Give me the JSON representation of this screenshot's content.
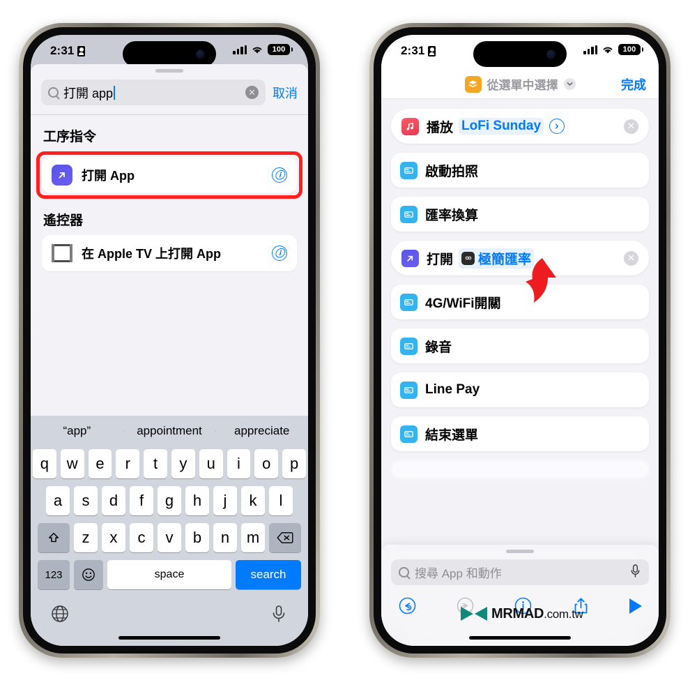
{
  "status_bar": {
    "time": "2:31",
    "battery": "100",
    "lock_icon": "lock-portrait-icon",
    "signal_icon": "cellular-signal-icon",
    "wifi_icon": "wifi-icon"
  },
  "left_phone": {
    "search": {
      "value": "打開 app",
      "clear_label": "✕",
      "cancel_label": "取消",
      "search_icon": "search-icon"
    },
    "sections": [
      {
        "title": "工序指令",
        "highlighted": true,
        "items": [
          {
            "label": "打開 App",
            "icon": "open-app-icon",
            "info": "ⓘ"
          }
        ]
      },
      {
        "title": "遙控器",
        "highlighted": false,
        "items": [
          {
            "label": "在 Apple TV 上打開 App",
            "icon": "apple-tv-icon",
            "info": "ⓘ"
          }
        ]
      }
    ],
    "keyboard": {
      "predictions": [
        "“app”",
        "appointment",
        "appreciate"
      ],
      "row1": [
        "q",
        "w",
        "e",
        "r",
        "t",
        "y",
        "u",
        "i",
        "o",
        "p"
      ],
      "row2": [
        "a",
        "s",
        "d",
        "f",
        "g",
        "h",
        "j",
        "k",
        "l"
      ],
      "row3": [
        "z",
        "x",
        "c",
        "v",
        "b",
        "n",
        "m"
      ],
      "shift_icon": "shift-arrow-icon",
      "backspace_icon": "backspace-icon",
      "numbers_label": "123",
      "emoji_icon": "emoji-smiley-icon",
      "space_label": "space",
      "search_label": "search",
      "globe_icon": "globe-icon",
      "mic_icon": "microphone-icon"
    }
  },
  "right_phone": {
    "header": {
      "shortcut_name": "從選單中選擇",
      "icon": "menu-select-icon",
      "chevron_icon": "chevron-down-icon",
      "done_label": "完成"
    },
    "actions": [
      {
        "verb": "播放",
        "param": "LoFi Sunday",
        "icon": "music-icon",
        "style": "pill",
        "has_chevron": true,
        "has_x": true
      },
      {
        "verb": "啟動拍照",
        "param": "",
        "icon": "shortcut-icon",
        "style": "card",
        "has_chevron": false,
        "has_x": false
      },
      {
        "verb": "匯率換算",
        "param": "",
        "icon": "shortcut-icon",
        "style": "card",
        "has_chevron": false,
        "has_x": false
      },
      {
        "verb": "打開",
        "param": "極簡匯率",
        "icon": "open-app-icon",
        "param_icon": "rate-app-icon",
        "style": "pill",
        "has_chevron": false,
        "has_x": true
      },
      {
        "verb": "4G/WiFi開關",
        "param": "",
        "icon": "shortcut-icon",
        "style": "card",
        "has_chevron": false,
        "has_x": false
      },
      {
        "verb": "錄音",
        "param": "",
        "icon": "shortcut-icon",
        "style": "card",
        "has_chevron": false,
        "has_x": false
      },
      {
        "verb": "Line Pay",
        "param": "",
        "icon": "shortcut-icon",
        "style": "card",
        "has_chevron": false,
        "has_x": false
      },
      {
        "verb": "結束選單",
        "param": "",
        "icon": "shortcut-icon",
        "style": "card",
        "has_chevron": false,
        "has_x": false
      }
    ],
    "bottom": {
      "search_placeholder": "搜尋 App 和動作",
      "search_icon": "search-icon",
      "mic_icon": "microphone-icon",
      "undo_icon": "undo-icon",
      "redo_icon": "redo-icon",
      "info_icon": "info-circle-icon",
      "share_icon": "share-icon",
      "play_icon": "play-icon"
    }
  },
  "annotations": {
    "arrow_color": "#ee1c20",
    "highlight_color": "#ff1f1f"
  },
  "watermark": {
    "name": "MRMAD",
    "tld": ".com.tw",
    "logo_icon": "mrmad-logo-icon",
    "logo_color": "#1a8f7e"
  }
}
